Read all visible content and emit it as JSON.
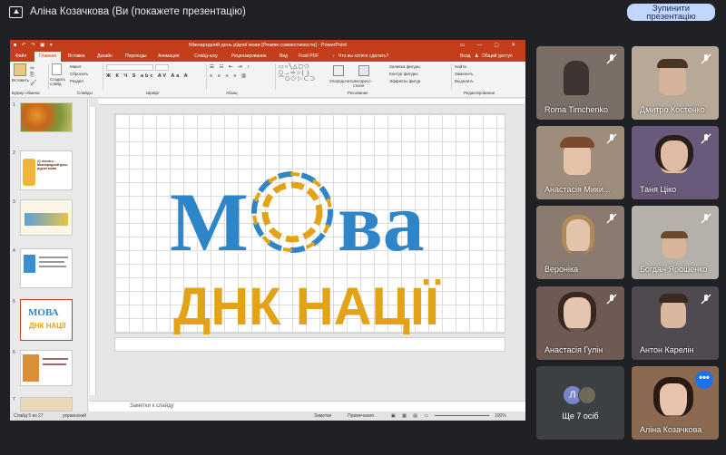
{
  "meet": {
    "presenter_title": "Аліна Козачкова (Ви (покажете презентацію)",
    "stop_button_line1": "Зупинити",
    "stop_button_line2": "презентацію",
    "present_icon": "present-screen-icon",
    "participants": [
      {
        "name": "Roma Timchenko"
      },
      {
        "name": "Дмитро Костенко"
      },
      {
        "name": "Анастасія Мики..."
      },
      {
        "name": "Таня Ціко"
      },
      {
        "name": "Вероніка"
      },
      {
        "name": "Богдан Ярошенко"
      },
      {
        "name": "Анастасія Гулін"
      },
      {
        "name": "Антон Карелін"
      },
      {
        "name": "Аліна Козачкова"
      }
    ],
    "more_tile": {
      "label": "Ще 7 осіб",
      "avatar_letter": "Л"
    },
    "colors": {
      "background": "#202124",
      "tile": "#3c4043",
      "stop_button": "#c2d7ff",
      "avatar_purple": "#7986cb",
      "more_menu": "#1a73e8"
    }
  },
  "ppt": {
    "window_title": "Міжнародний день рідної мови [Режим совместимости] - PowerPoint",
    "tabs": [
      "Файл",
      "Главная",
      "Вставка",
      "Дизайн",
      "Переходы",
      "Анимация",
      "Слайд-шоу",
      "Рецензирование",
      "Вид",
      "Foxit PDF"
    ],
    "tell_me": "Что вы хотите сделать?",
    "sign_in": "Вход",
    "share": "Общий доступ",
    "ribbon": {
      "paste": "Вставить",
      "create_slide": "Создать слайд",
      "layout": "Макет",
      "reset": "Сбросить",
      "section": "Раздел",
      "clipboard": "Буфер обмена",
      "slides": "Слайды",
      "font": "Шрифт",
      "paragraph": "Абзац",
      "arrange": "Упорядочить",
      "express_styles": "Экспресс-стили",
      "drawing": "Рисование",
      "shape_fill": "Заливка фигуры",
      "shape_outline": "Контур фигуры",
      "shape_effects": "Эффекты фигур",
      "find": "Найти",
      "replace": "Заменить",
      "select": "Выделить",
      "editing": "Редактирование"
    },
    "slide_numbers": [
      "1",
      "2",
      "3",
      "4",
      "5",
      "6",
      "7"
    ],
    "selected_slide": 5,
    "thumb_2_text": "21 лютого - Міжнародний день рідної мови",
    "slide_logo_top": "МОВА",
    "slide_logo_bottom": "ДНК НАЦІЇ",
    "logo_colors": {
      "blue": "#2e86c8",
      "yellow": "#e2a318"
    },
    "notes_placeholder": "Заметки к слайду",
    "status": {
      "slide_counter": "Слайд 5 из 27",
      "language": "украинский",
      "notes": "Заметки",
      "comments": "Примечания",
      "zoom": "100%"
    },
    "colors": {
      "accent": "#c43e1c"
    }
  }
}
